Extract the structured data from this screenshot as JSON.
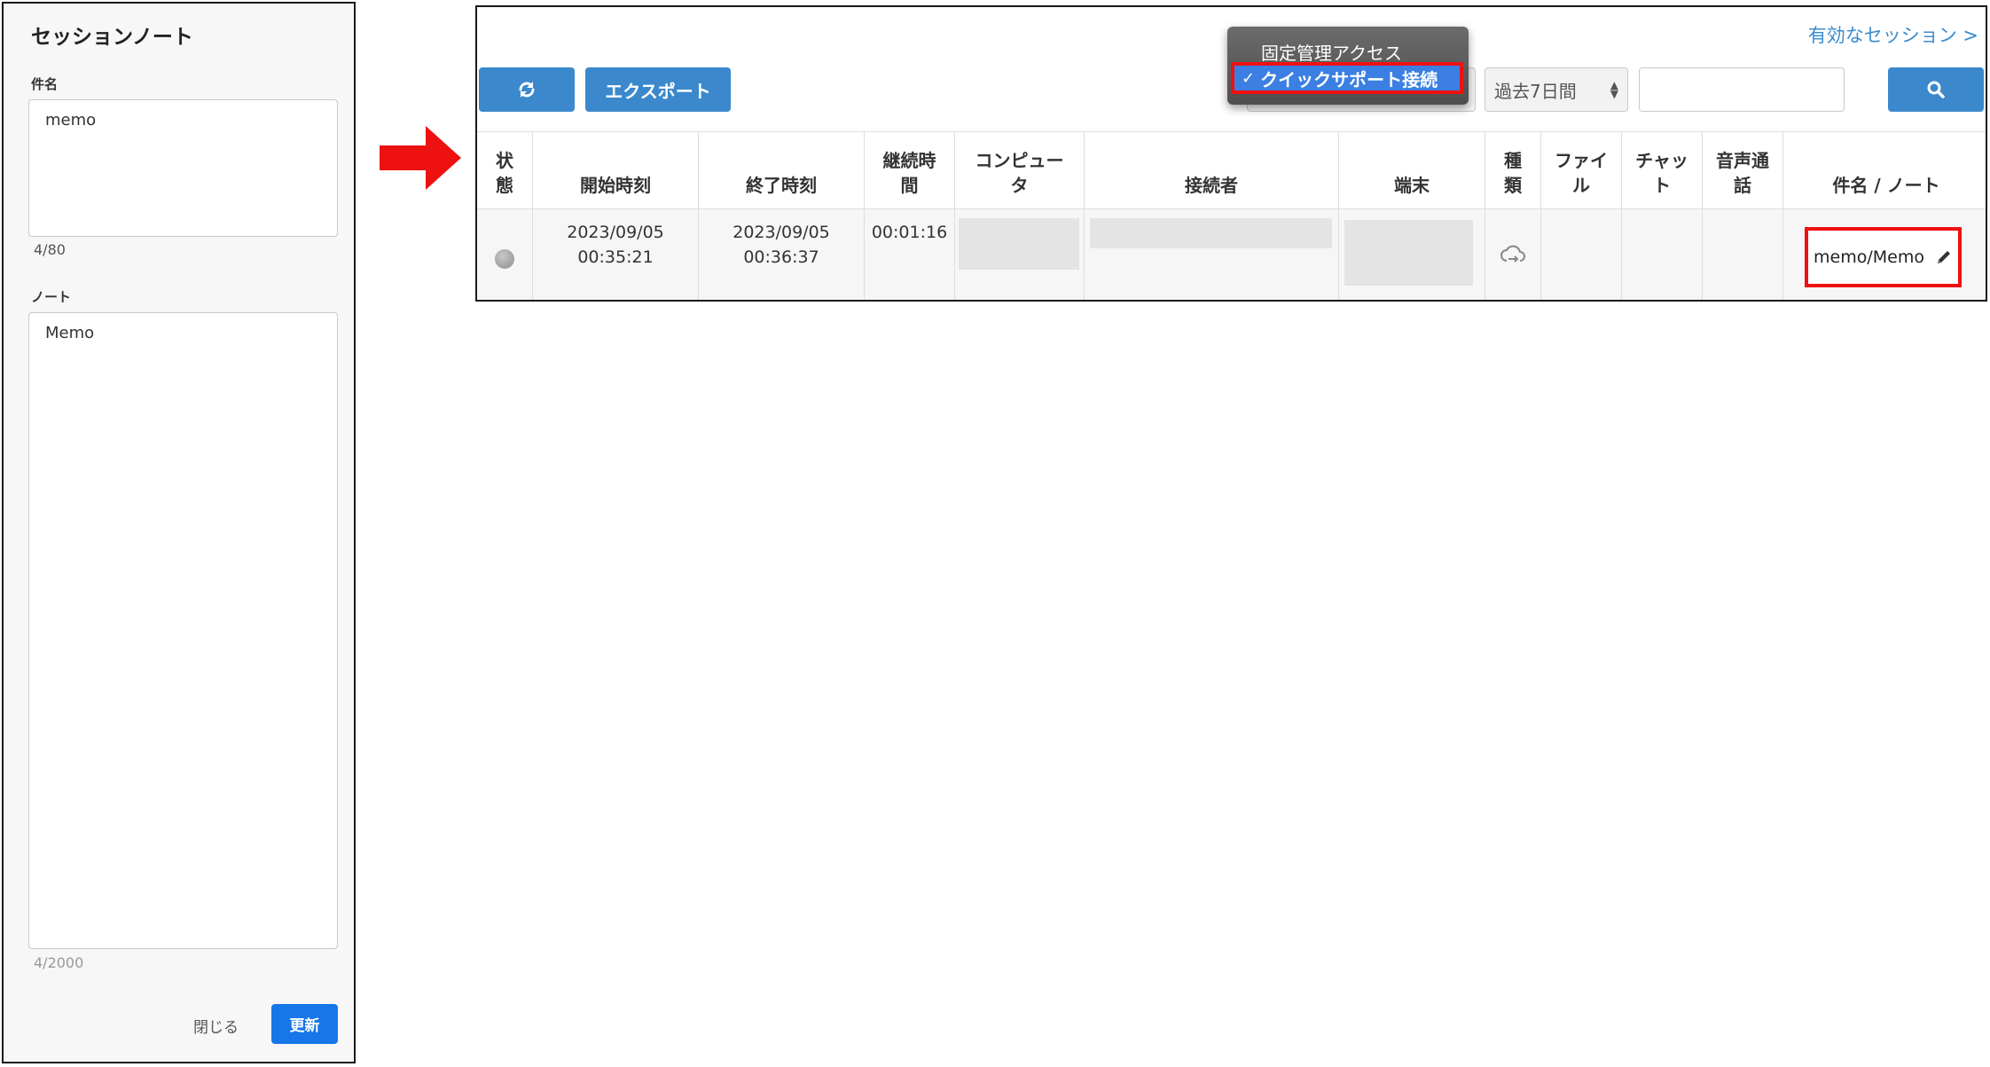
{
  "note_panel": {
    "title": "セッションノート",
    "subject_label": "件名",
    "subject_value": "memo",
    "subject_counter": "4/80",
    "note_label": "ノート",
    "note_value": "Memo",
    "note_counter": "4/2000",
    "close_label": "閉じる",
    "update_label": "更新"
  },
  "toolbar": {
    "active_sessions_link": "有効なセッション >",
    "export_label": "エクスポート",
    "period_value": "過去7日間",
    "search_value": ""
  },
  "dropdown": {
    "items": [
      "固定管理アクセス",
      "クイックサポート接続"
    ],
    "selected_index": 1
  },
  "table": {
    "columns": [
      "状\n態",
      "開始時刻",
      "終了時刻",
      "継続時\n間",
      "コンピュー\nタ",
      "接続者",
      "端末",
      "種\n類",
      "ファイ\nル",
      "チャッ\nト",
      "音声通\n話",
      "件名 / ノート"
    ],
    "rows": [
      {
        "start": "2023/09/05\n00:35:21",
        "end": "2023/09/05\n00:36:37",
        "duration": "00:01:16",
        "subject_note": "memo/Memo"
      }
    ]
  },
  "colors": {
    "accent_blue": "#3b89cc",
    "update_blue": "#1776e8",
    "highlight_red": "#ee1111",
    "link_blue": "#3a8cd0"
  },
  "icons": {
    "refresh": "refresh-icon",
    "search": "search-icon",
    "arrow": "arrow-right-icon",
    "cloud": "cloud-icon",
    "pencil": "pencil-icon",
    "check": "check-icon"
  }
}
